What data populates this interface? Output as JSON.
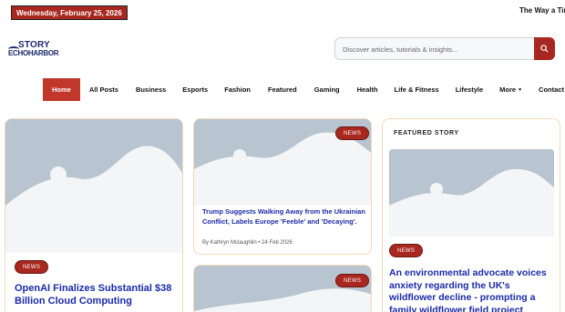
{
  "topbar": {
    "date": "Wednesday, February 25, 2026",
    "ticker": "The Way a Tiny"
  },
  "logo": {
    "top": "STORY",
    "bottom": "ECHOHARBOR"
  },
  "search": {
    "placeholder": "Discover articles, tutorials & insights...",
    "icon": "search-icon"
  },
  "nav": {
    "items": [
      "Home",
      "All Posts",
      "Business",
      "Esports",
      "Fashion",
      "Featured",
      "Gaming",
      "Health",
      "Life & Fitness",
      "Lifestyle",
      "More",
      "Contact Us"
    ],
    "active": "Home"
  },
  "cards": {
    "left": {
      "badge": "NEWS",
      "title": "OpenAI Finalizes Substantial $38 Billion Cloud Computing"
    },
    "middle": {
      "badge": "NEWS",
      "title": "Trump Suggests Walking Away from the Ukrainian Conflict, Labels Europe 'Feeble' and 'Decaying'.",
      "author": "By Kathryn Mclaughlin",
      "date": "24 Feb 2026"
    },
    "middle_bottom": {
      "badge": "NEWS"
    },
    "featured": {
      "label": "FEATURED STORY",
      "badge": "NEWS",
      "title": "An environmental advocate voices anxiety regarding the UK's wildflower decline - prompting a family wildflower field project"
    }
  },
  "colors": {
    "accent": "#a8271f",
    "link": "#1b2aa8",
    "card_border": "#f1d9b8",
    "placeholder": "#b8c4cf"
  }
}
